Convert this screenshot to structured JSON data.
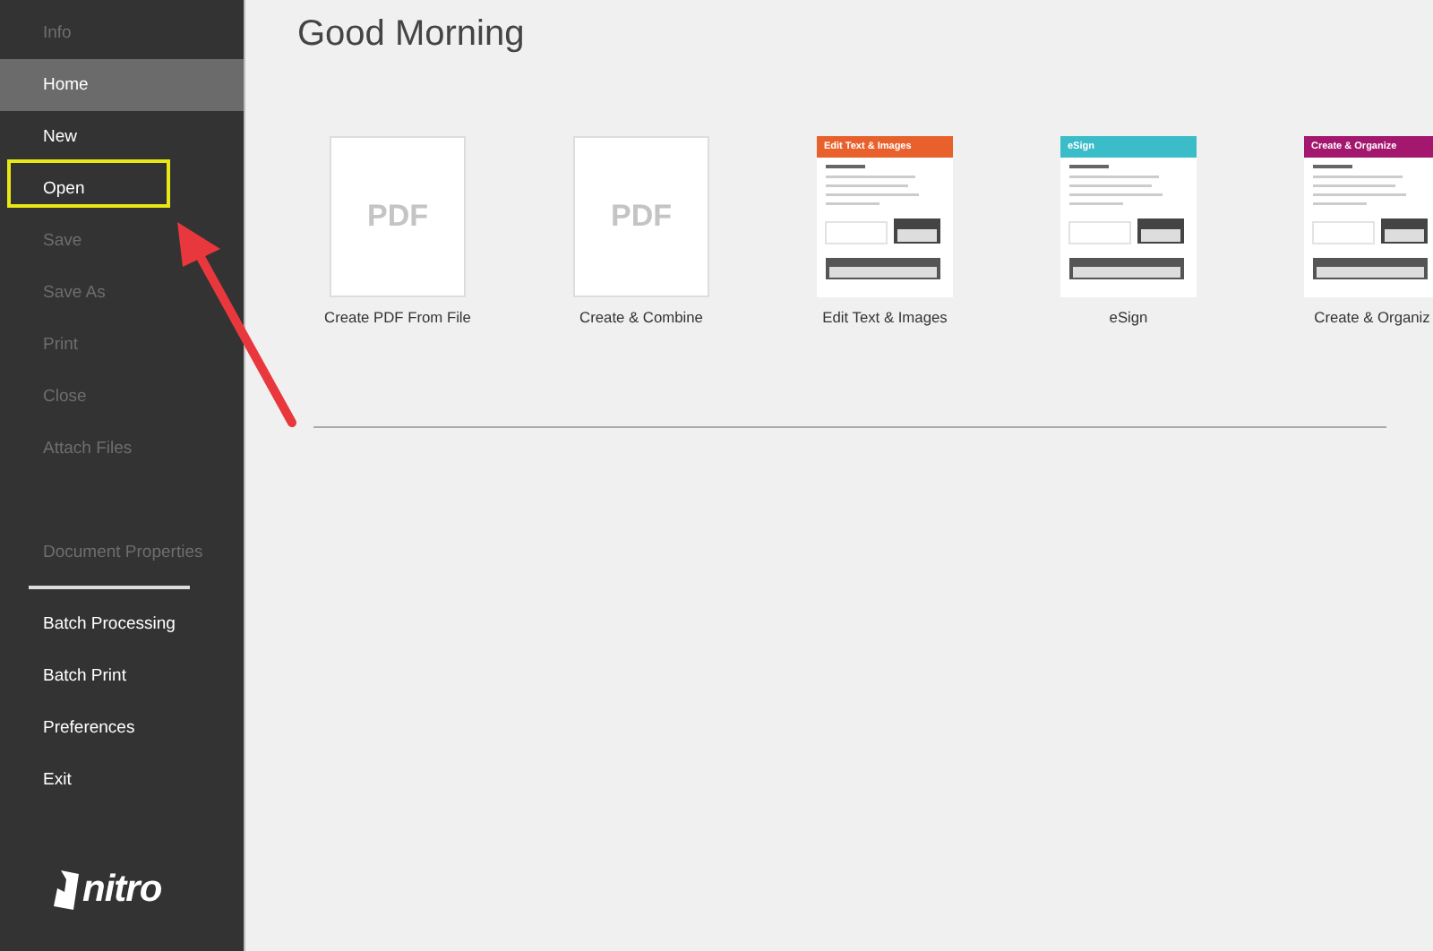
{
  "sidebar": {
    "sections": [
      {
        "items": [
          {
            "label": "Info",
            "enabled": false,
            "selected": false
          },
          {
            "label": "Home",
            "enabled": true,
            "selected": true
          },
          {
            "label": "New",
            "enabled": true,
            "selected": false
          },
          {
            "label": "Open",
            "enabled": true,
            "selected": false
          },
          {
            "label": "Save",
            "enabled": false,
            "selected": false
          },
          {
            "label": "Save As",
            "enabled": false,
            "selected": false
          },
          {
            "label": "Print",
            "enabled": false,
            "selected": false
          },
          {
            "label": "Close",
            "enabled": false,
            "selected": false
          },
          {
            "label": "Attach Files",
            "enabled": false,
            "selected": false
          }
        ]
      },
      {
        "items": [
          {
            "label": "Document Properties",
            "enabled": false,
            "selected": false
          }
        ]
      },
      {
        "items": [
          {
            "label": "Batch Processing",
            "enabled": true,
            "selected": false
          },
          {
            "label": "Batch Print",
            "enabled": true,
            "selected": false
          },
          {
            "label": "Preferences",
            "enabled": true,
            "selected": false
          },
          {
            "label": "Exit",
            "enabled": true,
            "selected": false
          }
        ]
      }
    ],
    "logo": "nitro"
  },
  "greeting": "Good Morning",
  "cards": [
    {
      "kind": "blank",
      "thumb_text": "PDF",
      "label": "Create PDF From File"
    },
    {
      "kind": "blank",
      "thumb_text": "PDF",
      "label": "Create & Combine"
    },
    {
      "kind": "template",
      "header": "Edit Text & Images",
      "color": "#e8612c",
      "label": "Edit Text & Images"
    },
    {
      "kind": "template",
      "header": "eSign",
      "color": "#3bbcc9",
      "label": "eSign"
    },
    {
      "kind": "template",
      "header": "Create & Organize",
      "color": "#a3176e",
      "label": "Create & Organiz"
    }
  ]
}
